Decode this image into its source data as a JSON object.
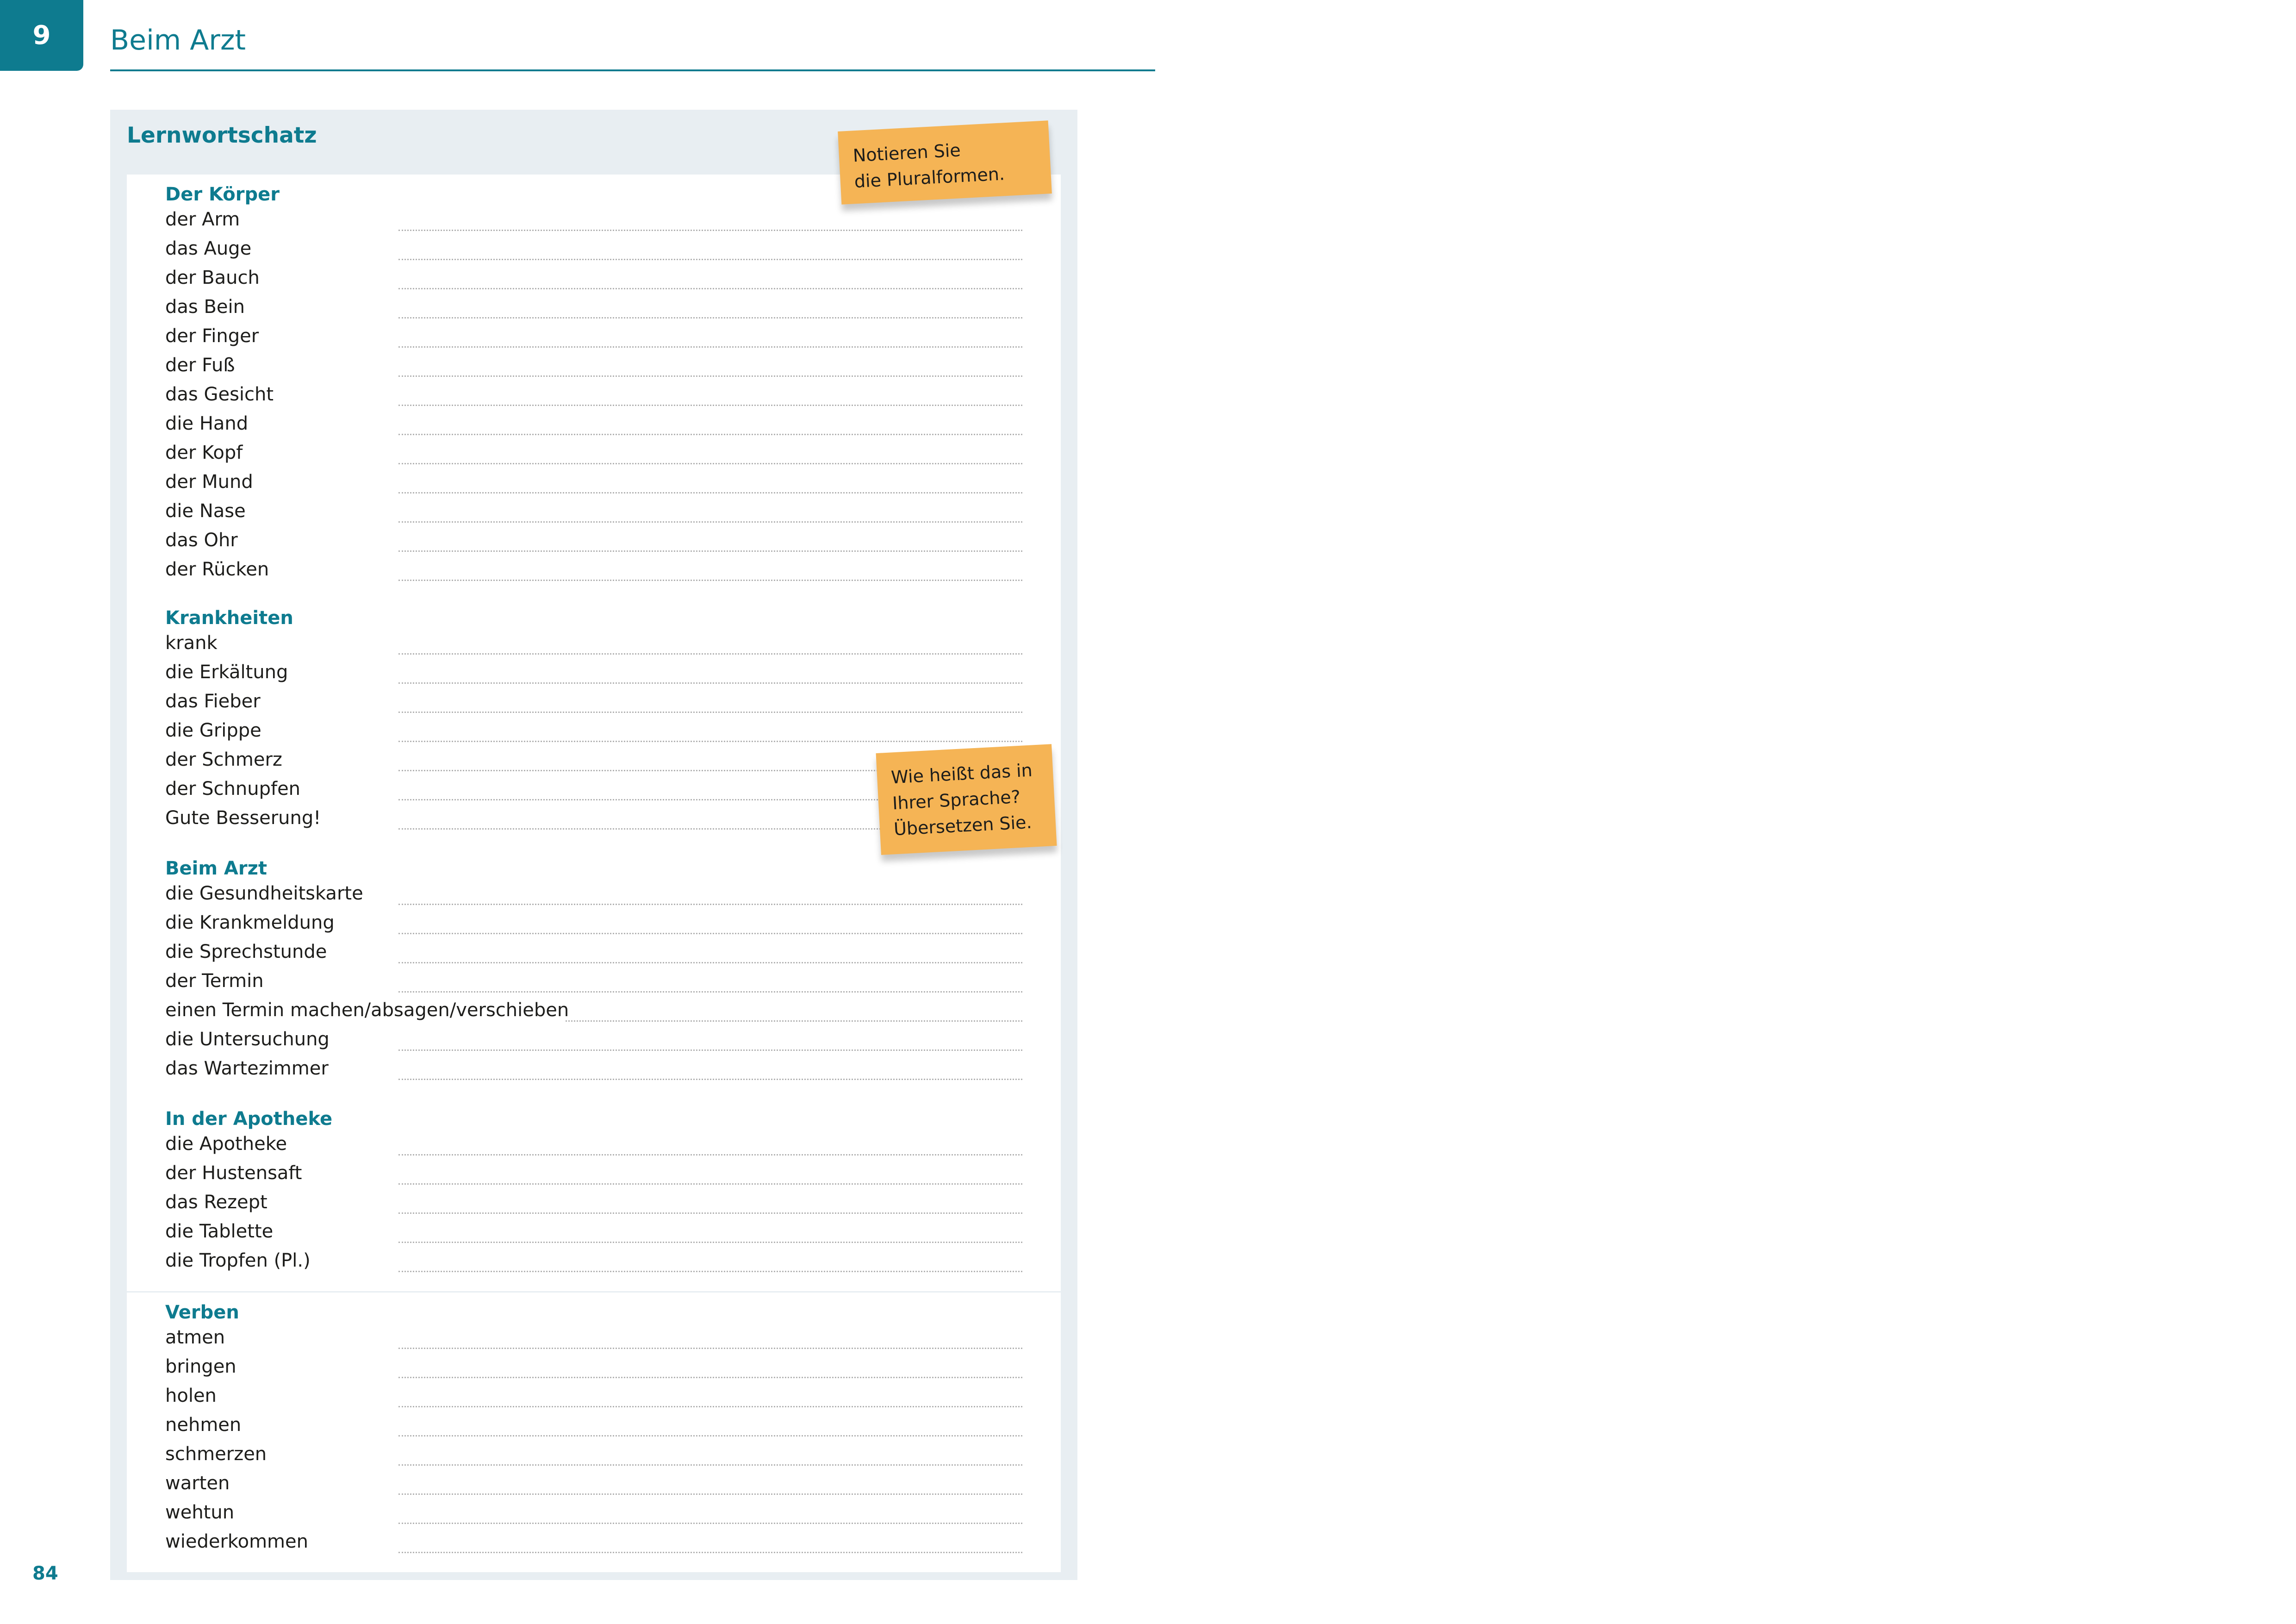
{
  "page": {
    "chapter_number": "9",
    "chapter_title": "Beim Arzt",
    "page_number": "84"
  },
  "colors": {
    "accent": "#0e7b8f",
    "panel_background": "#e8eef2",
    "sticky_note": "#f5b455"
  },
  "vocabulary": {
    "heading": "Lernwortschatz",
    "sections": [
      {
        "heading": "Der Körper",
        "items": [
          "der Arm",
          "das Auge",
          "der Bauch",
          "das Bein",
          "der Finger",
          "der Fuß",
          "das Gesicht",
          "die Hand",
          "der Kopf",
          "der Mund",
          "die Nase",
          "das Ohr",
          "der Rücken"
        ]
      },
      {
        "heading": "Krankheiten",
        "items": [
          "krank",
          "die Erkältung",
          "das Fieber",
          "die Grippe",
          "der Schmerz",
          "der Schnupfen",
          "Gute Besserung!"
        ]
      },
      {
        "heading": "Beim Arzt",
        "items": [
          "die Gesundheitskarte",
          "die Krankmeldung",
          "die Sprechstunde",
          "der Termin",
          "einen Termin machen/absagen/verschieben",
          "die Untersuchung",
          "das Wartezimmer"
        ]
      },
      {
        "heading": "In der Apotheke",
        "items": [
          "die Apotheke",
          "der Hustensaft",
          "das Rezept",
          "die Tablette",
          "die Tropfen (Pl.)"
        ]
      },
      {
        "heading": "Verben",
        "items": [
          "atmen",
          "bringen",
          "holen",
          "nehmen",
          "schmerzen",
          "warten",
          "wehtun",
          "wiederkommen"
        ]
      }
    ]
  },
  "notes": {
    "plural": [
      "Notieren Sie",
      "die Pluralformen."
    ],
    "translate": [
      "Wie heißt das in",
      "Ihrer Sprache?",
      "Übersetzen Sie."
    ]
  }
}
